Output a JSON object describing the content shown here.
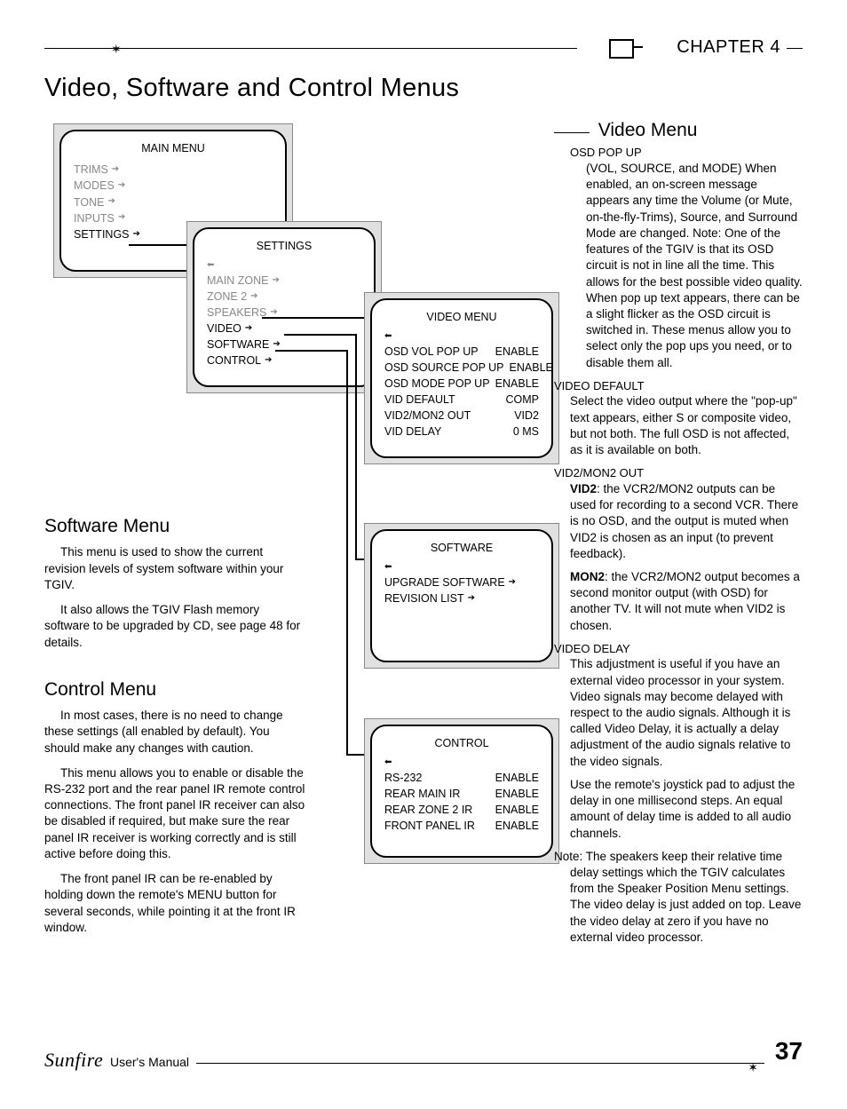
{
  "header": {
    "chapter": "CHAPTER 4"
  },
  "title": "Video, Software and Control Menus",
  "main_menu": {
    "title": "MAIN MENU",
    "items": [
      "TRIMS",
      "MODES",
      "TONE",
      "INPUTS",
      "SETTINGS"
    ]
  },
  "settings_menu": {
    "title": "SETTINGS",
    "items": [
      "MAIN ZONE",
      "ZONE 2",
      "SPEAKERS",
      "VIDEO",
      "SOFTWARE",
      "CONTROL"
    ]
  },
  "video_menu_screen": {
    "title": "VIDEO MENU",
    "rows": [
      {
        "k": "OSD VOL POP UP",
        "v": "ENABLE"
      },
      {
        "k": "OSD SOURCE  POP UP",
        "v": "ENABLE"
      },
      {
        "k": "OSD MODE POP UP",
        "v": "ENABLE"
      },
      {
        "k": "VID DEFAULT",
        "v": "COMP"
      },
      {
        "k": "VID2/MON2 OUT",
        "v": "VID2"
      },
      {
        "k": "VID DELAY",
        "v": "0 MS"
      }
    ]
  },
  "software_menu_screen": {
    "title": "SOFTWARE",
    "rows": [
      "UPGRADE SOFTWARE",
      "REVISION LIST"
    ]
  },
  "control_menu_screen": {
    "title": "CONTROL",
    "rows": [
      {
        "k": "RS-232",
        "v": "ENABLE"
      },
      {
        "k": "REAR MAIN IR",
        "v": "ENABLE"
      },
      {
        "k": "REAR ZONE 2 IR",
        "v": "ENABLE"
      },
      {
        "k": "FRONT PANEL IR",
        "v": "ENABLE"
      }
    ]
  },
  "software_section": {
    "heading": "Software Menu",
    "p1": "This menu is used to show the current revision levels of system software within your TGIV.",
    "p2": "It also allows the TGIV Flash memory software to be upgraded by CD, see page 48 for details."
  },
  "control_section": {
    "heading": "Control Menu",
    "p1": "In most cases, there is no need to change these settings (all enabled by default). You should make any changes with caution.",
    "p2": "This menu allows you to enable or disable the RS-232 port and the rear panel IR remote control connections. The front panel IR receiver can also be disabled if required, but make sure the rear panel IR receiver is working correctly and is still active before doing this.",
    "p3": "The front panel IR can be re-enabled by holding down the remote's MENU button for several seconds, while pointing it at the front IR window."
  },
  "video_section": {
    "heading": "Video Menu",
    "osd": {
      "term": "OSD POP UP",
      "body": "(VOL, SOURCE, and MODE) When enabled, an on-screen message appears any time the Volume (or Mute, on-the-fly-Trims), Source, and Surround Mode are changed. Note: One of the features of the TGIV is that its OSD circuit is not in line all the time. This allows for the best possible video quality. When pop up text appears, there can be a slight flicker as the OSD circuit is switched in. These menus allow you to select only the pop ups you need, or to disable them all."
    },
    "viddef": {
      "term": "VIDEO DEFAULT",
      "body": "Select the video output where the \"pop-up\" text appears, either S or composite video, but not both. The full OSD is not affected, as it is available on both."
    },
    "vid2": {
      "term": "VID2/MON2 OUT",
      "body1a": "VID2",
      "body1b": ": the VCR2/MON2 outputs can be used for recording to a second VCR. There is no OSD, and the output is muted when VID2 is chosen as an input (to prevent feedback).",
      "body2a": "MON2",
      "body2b": ": the VCR2/MON2 output becomes a second monitor output (with OSD) for another TV. It will not mute when VID2 is chosen."
    },
    "delay": {
      "term": "VIDEO DELAY",
      "body1": "This adjustment is useful if you have an external video processor in your system. Video signals may become delayed with respect to the audio signals. Although it is called Video Delay, it is actually a delay adjustment of the audio signals relative to the video signals.",
      "body2": "Use the remote's joystick pad to adjust the delay in one millisecond steps. An equal amount of delay time is added to all audio channels."
    },
    "note": "Note: The speakers keep their relative time delay settings which the TGIV calculates from the Speaker Position Menu settings. The video delay is just added on top. Leave the video delay at zero if you have no external video processor."
  },
  "footer": {
    "brand": "Sunfire",
    "label": "User's Manual",
    "page": "37"
  }
}
